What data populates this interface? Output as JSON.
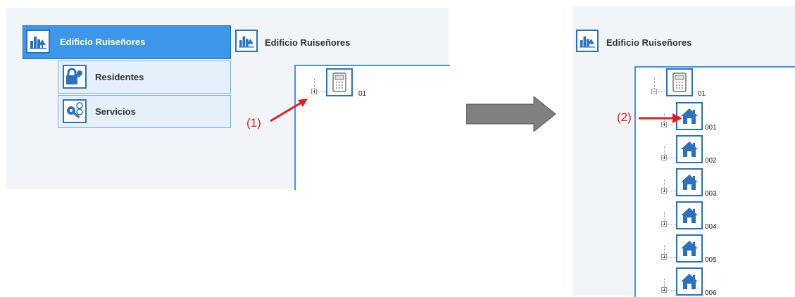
{
  "left": {
    "menu_main_label": "Edificio Ruiseñores",
    "sub_items": [
      {
        "label": "Residentes",
        "icon": "resident-key-icon"
      },
      {
        "label": "Servicios",
        "icon": "services-key-icon"
      }
    ],
    "tree_header": "Edificio Ruiseñores",
    "tree_root_label": "01",
    "annotation": "(1)"
  },
  "right": {
    "tree_header": "Edificio Ruiseñores",
    "tree_root_label": "01",
    "annotation": "(2)",
    "units": [
      "001",
      "002",
      "003",
      "004",
      "005",
      "006"
    ]
  },
  "colors": {
    "accent": "#3c96ea",
    "icon_blue": "#2a72c1",
    "annotation_red": "#e81c1c",
    "arrow_gray": "#808080"
  }
}
